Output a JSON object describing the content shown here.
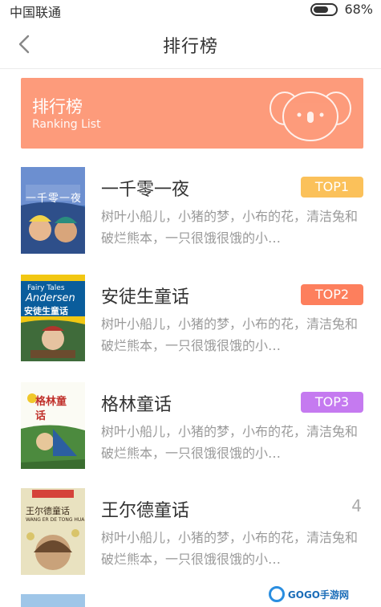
{
  "status_bar": {
    "carrier": "中国联通",
    "battery": "68%"
  },
  "nav": {
    "title": "排行榜"
  },
  "banner": {
    "title": "排行榜",
    "subtitle": "Ranking List",
    "color": "#fd9b7b"
  },
  "items": [
    {
      "title": "一千零一夜",
      "badge": "TOP1",
      "badge_color": "#fbc15a",
      "desc": "树叶小船儿，小猪的梦，小布的花，清洁兔和破烂熊本，一只很饿很饿的小…",
      "cover_text": "一千零一夜"
    },
    {
      "title": "安徒生童话",
      "badge": "TOP2",
      "badge_color": "#fd7f5d",
      "desc": "树叶小船儿，小猪的梦，小布的花，清洁兔和破烂熊本，一只很饿很饿的小…",
      "cover_text": "安徒生童话",
      "cover_sub": "Fairy Tales",
      "cover_en": "Andersen"
    },
    {
      "title": "格林童话",
      "badge": "TOP3",
      "badge_color": "#c57af0",
      "desc": "树叶小船儿，小猪的梦，小布的花，清洁兔和破烂熊本，一只很饿很饿的小…",
      "cover_text": "格林童话"
    },
    {
      "title": "王尔德童话",
      "rank": "4",
      "desc": "树叶小船儿，小猪的梦，小布的花，清洁兔和破烂熊本，一只很饿很饿的小…",
      "cover_text": "王尔德童话",
      "cover_pinyin": "WANG ER DE TONG HUA"
    }
  ],
  "watermark": {
    "text": "GOGO手游网"
  }
}
